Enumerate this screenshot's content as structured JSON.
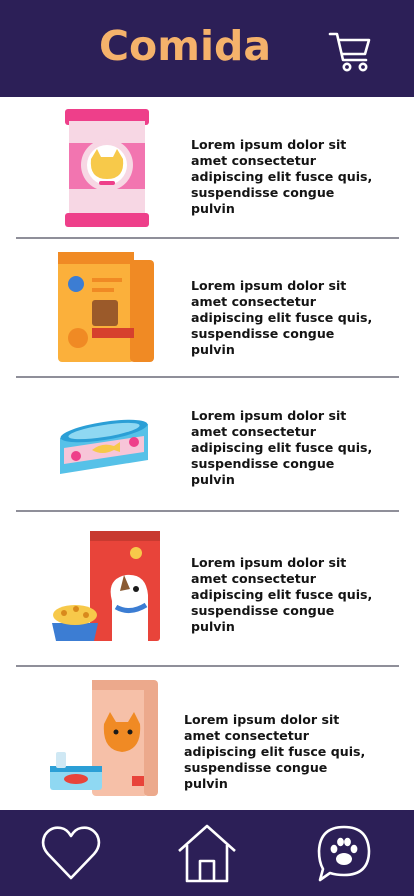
{
  "header": {
    "title": "Comida",
    "cart_icon": "shopping-cart-icon"
  },
  "products": [
    {
      "image": "cat-food-bag-pink-icon",
      "description": "Lorem ipsum dolor sit amet consectetur adipiscing elit fusce quis, suspendisse congue pulvin"
    },
    {
      "image": "dog-food-bag-orange-icon",
      "description": "Lorem ipsum dolor sit amet consectetur adipiscing elit fusce quis, suspendisse congue pulvin"
    },
    {
      "image": "cat-food-can-icon",
      "description": "Lorem ipsum dolor sit amet consectetur adipiscing elit fusce quis, suspendisse congue pulvin"
    },
    {
      "image": "dog-food-bag-and-bowl-icon",
      "description": "Lorem ipsum dolor sit amet consectetur adipiscing elit fusce quis, suspendisse congue pulvin"
    },
    {
      "image": "cat-food-bag-and-can-icon",
      "description": "Lorem ipsum dolor sit amet consectetur adipiscing elit fusce quis, suspendisse congue pulvin"
    }
  ],
  "tabbar": {
    "items": [
      {
        "icon": "heart-icon"
      },
      {
        "icon": "home-icon"
      },
      {
        "icon": "paw-chat-icon"
      }
    ]
  },
  "colors": {
    "header_bg": "#2c1f57",
    "title_color": "#f5b26b"
  }
}
